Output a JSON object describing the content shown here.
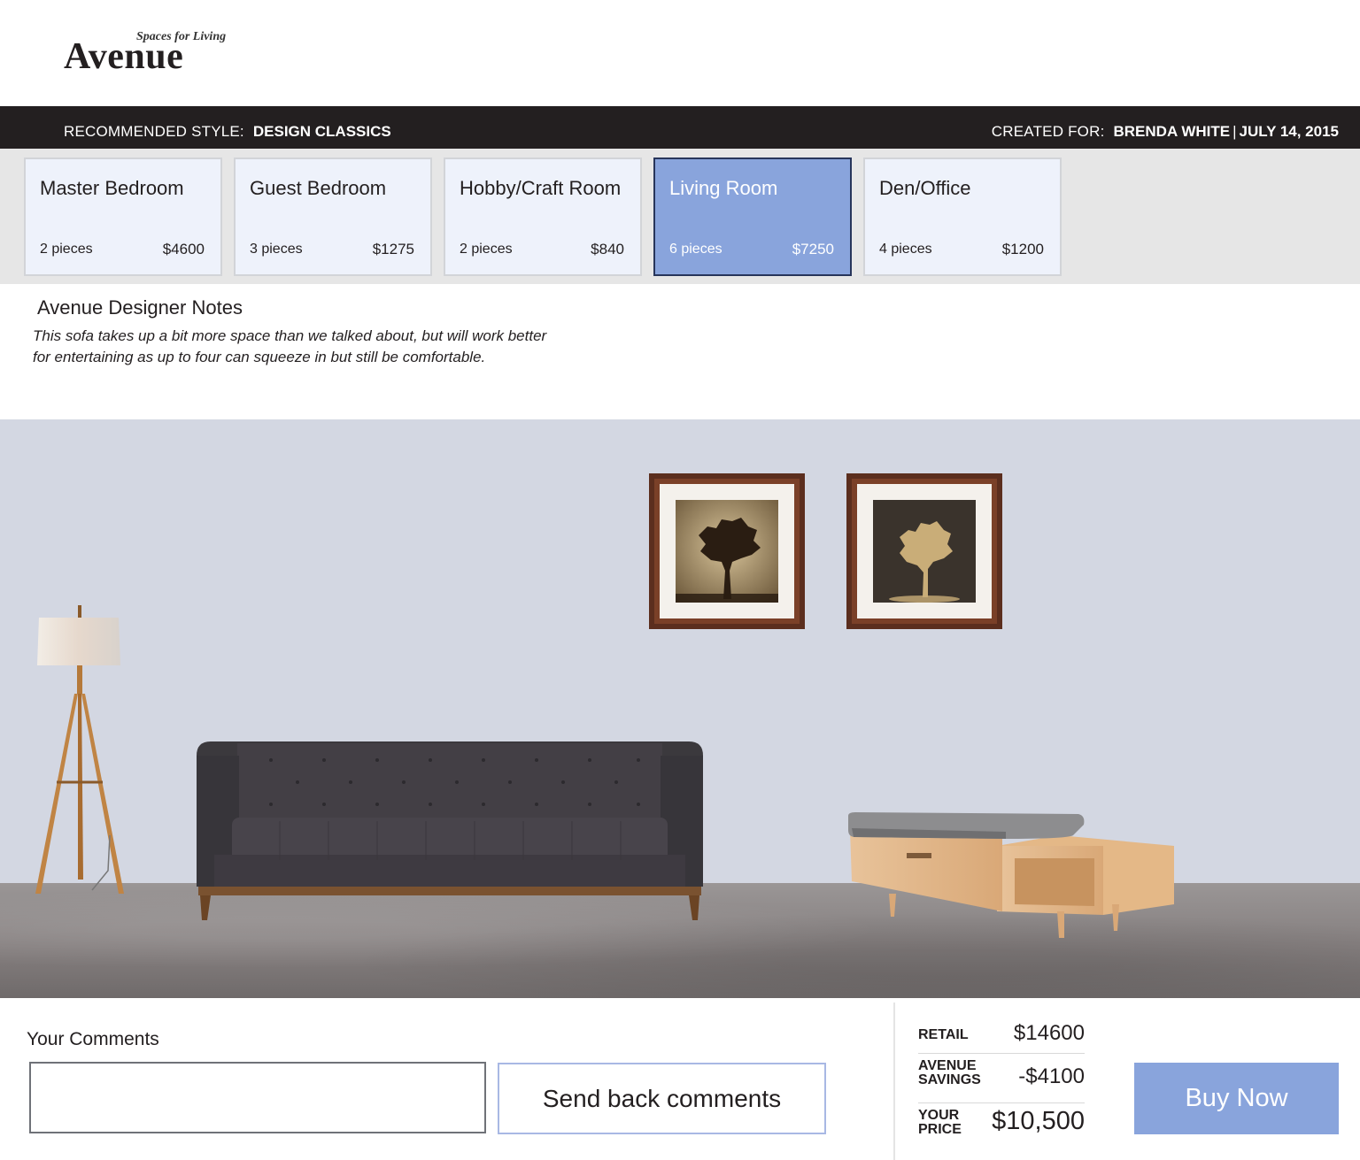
{
  "brand": {
    "name": "Avenue",
    "tagline": "Spaces for Living"
  },
  "topbar": {
    "style_label": "RECOMMENDED STYLE:",
    "style_value": "DESIGN CLASSICS",
    "created_label": "CREATED FOR:",
    "created_name": "BRENDA WHITE",
    "separator": "|",
    "created_date": "JULY 14, 2015"
  },
  "rooms": [
    {
      "name": "Master Bedroom",
      "pieces": "2 pieces",
      "price": "$4600"
    },
    {
      "name": "Guest Bedroom",
      "pieces": "3 pieces",
      "price": "$1275"
    },
    {
      "name": "Hobby/Craft Room",
      "pieces": "2 pieces",
      "price": "$840"
    },
    {
      "name": "Living Room",
      "pieces": "6 pieces",
      "price": "$7250"
    },
    {
      "name": "Den/Office",
      "pieces": "4 pieces",
      "price": "$1200"
    }
  ],
  "active_room": "Living Room",
  "notes": {
    "title": "Avenue Designer Notes",
    "body": "This sofa takes up a bit more space than we talked about, but will work better for entertaining as up to four can squeeze in but still be comfortable."
  },
  "comments": {
    "label": "Your Comments",
    "value": "",
    "send_label": "Send back comments"
  },
  "pricing": {
    "retail_label": "RETAIL",
    "retail_value": "$14600",
    "savings_label_1": "AVENUE",
    "savings_label_2": "SAVINGS",
    "savings_value": "-$4100",
    "price_label_1": "YOUR",
    "price_label_2": "PRICE",
    "price_value": "$10,500"
  },
  "buy_label": "Buy Now",
  "colors": {
    "accent": "#89a4dc",
    "tab_bg": "#eef2fb",
    "dark_bar": "#231f20",
    "wall": "#d3d7e2"
  }
}
